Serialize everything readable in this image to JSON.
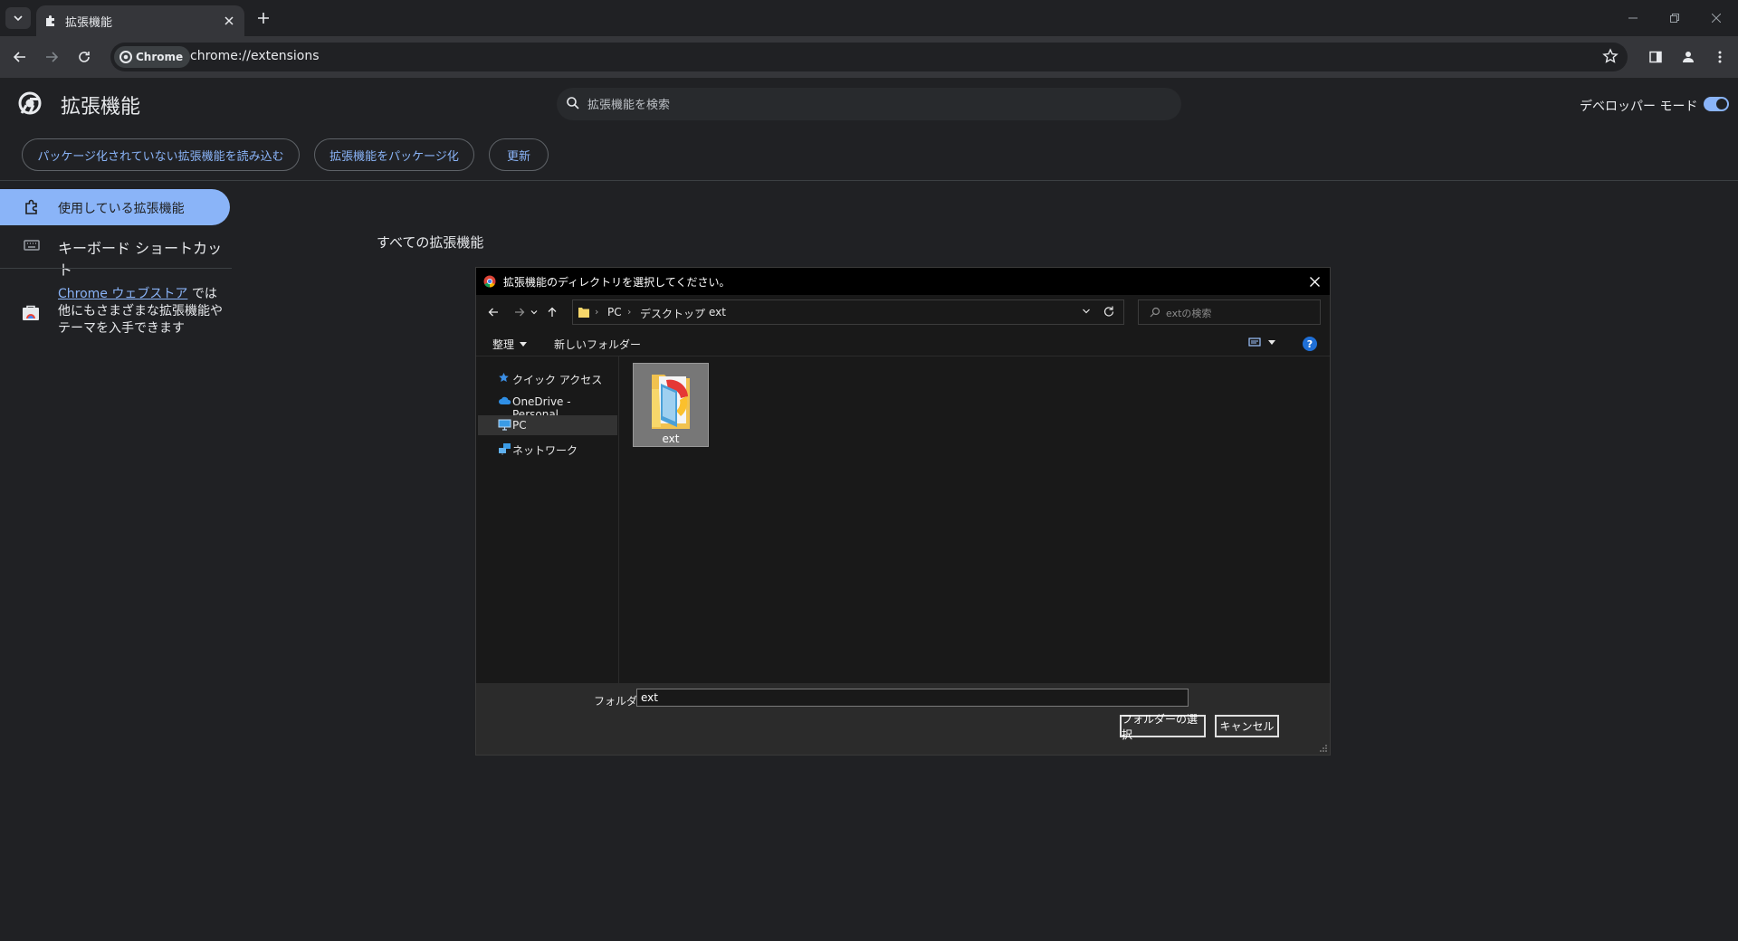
{
  "browser": {
    "tab": {
      "title": "拡張機能",
      "close_icon": "close-icon"
    },
    "chip_label": "Chrome",
    "url": "chrome://extensions"
  },
  "header": {
    "title": "拡張機能",
    "search_placeholder": "拡張機能を検索",
    "dev_mode_label": "デベロッパー モード",
    "dev_mode_on": true
  },
  "dev_buttons": {
    "load_unpacked": "パッケージ化されていない拡張機能を読み込む",
    "pack": "拡張機能をパッケージ化",
    "update": "更新"
  },
  "sidebar": {
    "items": [
      {
        "label": "使用している拡張機能",
        "icon": "extension-icon",
        "active": true
      },
      {
        "label": "キーボード ショートカット",
        "icon": "keyboard-icon",
        "active": false
      }
    ],
    "store": {
      "link": "Chrome ウェブストア",
      "text_after_link": " では",
      "text_rest": "他にもさまざまな拡張機能やテーマを入手できます"
    }
  },
  "main": {
    "section_title": "すべての拡張機能"
  },
  "dialog": {
    "title": "拡張機能のディレクトリを選択してください。",
    "breadcrumb": [
      "PC",
      "デスクトップ",
      "ext"
    ],
    "search_placeholder": "extの検索",
    "organize": "整理",
    "new_folder": "新しいフォルダー",
    "nav_items": [
      {
        "label": "クイック アクセス",
        "icon": "star-icon"
      },
      {
        "label": "OneDrive - Personal",
        "icon": "cloud-icon"
      },
      {
        "label": "PC",
        "icon": "computer-icon",
        "selected": true
      },
      {
        "label": "ネットワーク",
        "icon": "network-icon"
      }
    ],
    "items": [
      {
        "name": "ext",
        "icon": "folder-icon",
        "selected": true
      }
    ],
    "folder_label": "フォルダー:",
    "folder_value": "ext",
    "select_button": "フォルダーの選択",
    "cancel_button": "キャンセル"
  },
  "colors": {
    "page_bg": "#202124",
    "accent": "#8ab4f8",
    "toolbar_bg": "#35363a",
    "dialog_bg": "#191919"
  }
}
